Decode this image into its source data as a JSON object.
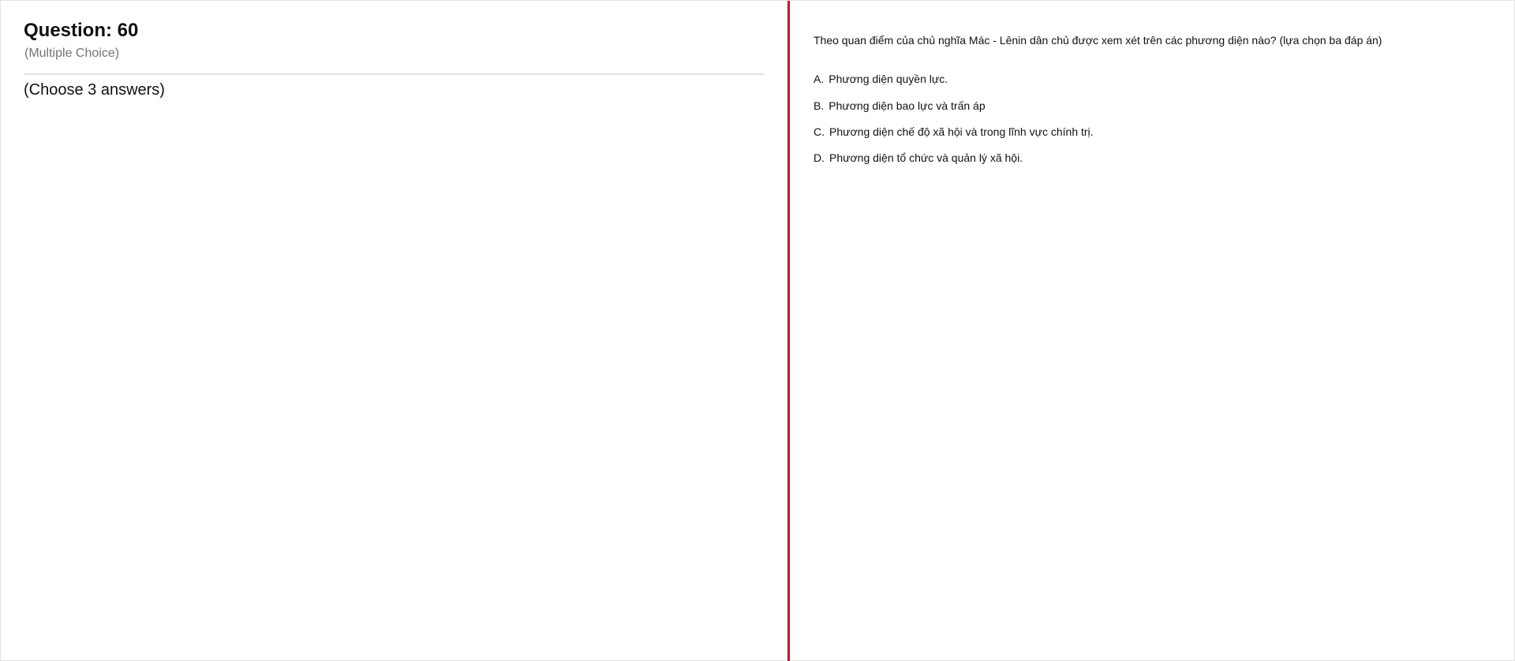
{
  "question": {
    "title": "Question: 60",
    "type": "(Multiple Choice)",
    "instruction": "(Choose 3 answers)",
    "text": "Theo quan điểm của chủ nghĩa Mác - Lênin dân chủ được xem xét trên các phương diện nào? (lựa chọn ba đáp án)",
    "options": [
      {
        "letter": "A.",
        "text": "Phương diện quyền lực."
      },
      {
        "letter": "B.",
        "text": "Phương diện bao lực và trấn áp"
      },
      {
        "letter": "C.",
        "text": "Phương diện chế độ xã hội và trong lĩnh vực chính trị."
      },
      {
        "letter": "D.",
        "text": "Phương diện tổ chức và quản lý xã hội."
      }
    ]
  },
  "colors": {
    "splitter": "#c8102e",
    "text": "#111111",
    "muted": "#757575",
    "divider": "#e2e2e2"
  }
}
